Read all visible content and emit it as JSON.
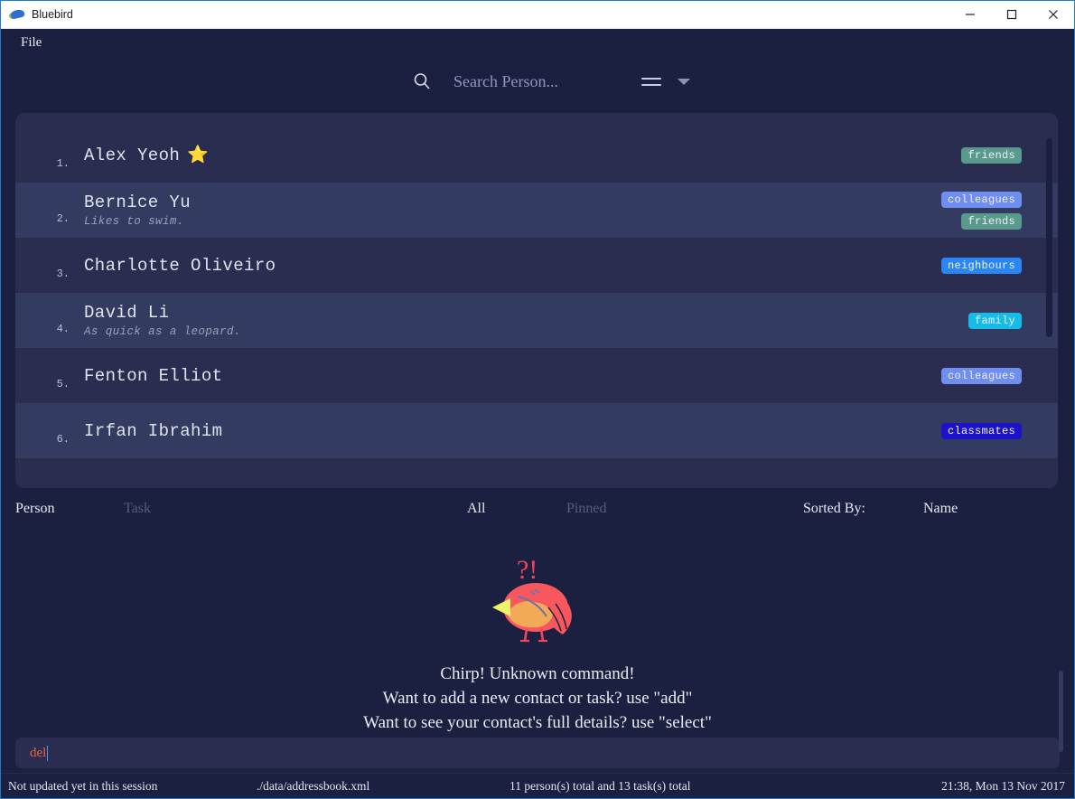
{
  "window": {
    "title": "Bluebird",
    "app_icon": "bluebird-logo-icon",
    "minimize_label": "─",
    "maximize_label": "□",
    "close_label": "✕"
  },
  "menubar": {
    "items": [
      {
        "label": "File"
      }
    ]
  },
  "search": {
    "icon": "search-icon",
    "placeholder": "Search Person...",
    "value": "",
    "menu_icon": "hamburger-icon",
    "dropdown_icon": "chevron-down-icon"
  },
  "person_list": [
    {
      "index": "1.",
      "name": "Alex Yeoh",
      "favorite": true,
      "favorite_icon": "star-icon",
      "remark": "",
      "tags": [
        {
          "label": "friends",
          "color": "#5a9a8c"
        }
      ]
    },
    {
      "index": "2.",
      "name": "Bernice Yu",
      "favorite": false,
      "remark": "Likes to swim.",
      "tags": [
        {
          "label": "colleagues",
          "color": "#6f8ef0"
        },
        {
          "label": "friends",
          "color": "#5a9a8c"
        }
      ]
    },
    {
      "index": "3.",
      "name": "Charlotte Oliveiro",
      "favorite": false,
      "remark": "",
      "tags": [
        {
          "label": "neighbours",
          "color": "#2a86f5"
        }
      ]
    },
    {
      "index": "4.",
      "name": "David Li",
      "favorite": false,
      "remark": "As quick as a leopard.",
      "tags": [
        {
          "label": "family",
          "color": "#16bce8"
        }
      ]
    },
    {
      "index": "5.",
      "name": "Fenton Elliot",
      "favorite": false,
      "remark": "",
      "tags": [
        {
          "label": "colleagues",
          "color": "#6f8ef0"
        }
      ]
    },
    {
      "index": "6.",
      "name": "Irfan Ibrahim",
      "favorite": false,
      "remark": "",
      "tags": [
        {
          "label": "classmates",
          "color": "#1c12c9"
        }
      ]
    }
  ],
  "tabs": {
    "person": "Person",
    "task": "Task",
    "all": "All",
    "pinned": "Pinned",
    "sorted_by_label": "Sorted By:",
    "sorted_by_value": "Name"
  },
  "result": {
    "mascot_icon": "confused-bird-mascot-icon",
    "line1": "Chirp! Unknown command!",
    "line2": "Want to add a new contact or task? use \"add\"",
    "line3": "Want to see your contact's full details? use \"select\""
  },
  "command": {
    "value": "del",
    "placeholder": "Enter command here..."
  },
  "status": {
    "sync": "Not updated yet in this session",
    "file": "./data/addressbook.xml",
    "totals": "11 person(s) total and 13 task(s) total",
    "datetime": "21:38, Mon 13 Nov 2017"
  },
  "colors": {
    "window_bg": "#1c2040",
    "row_odd": "#2a2d4f",
    "row_even": "#343b60",
    "accent_border": "#1a7fd4",
    "command_text": "#e8604c"
  }
}
